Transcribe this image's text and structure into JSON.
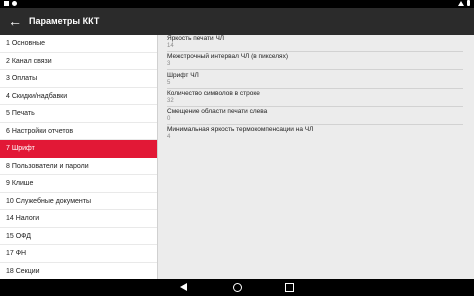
{
  "app_bar": {
    "title": "Параметры ККТ"
  },
  "sidebar": {
    "items": [
      {
        "label": "1 Основные"
      },
      {
        "label": "2 Канал связи"
      },
      {
        "label": "3 Оплаты"
      },
      {
        "label": "4 Скидки/надбавки"
      },
      {
        "label": "5 Печать"
      },
      {
        "label": "6 Настройки отчетов"
      },
      {
        "label": "7 Шрифт"
      },
      {
        "label": "8 Пользователи и пароли"
      },
      {
        "label": "9 Клише"
      },
      {
        "label": "10 Служебные документы"
      },
      {
        "label": "14 Налоги"
      },
      {
        "label": "15 ОФД"
      },
      {
        "label": "17 ФН"
      },
      {
        "label": "18 Секции"
      }
    ],
    "active_index": 6
  },
  "settings": [
    {
      "label": "Яркость печати ЧЛ",
      "value": "14"
    },
    {
      "label": "Межстрочный интервал ЧЛ (в пикселях)",
      "value": "3"
    },
    {
      "label": "Шрифт ЧЛ",
      "value": "5"
    },
    {
      "label": "Количество символов в строке",
      "value": "32"
    },
    {
      "label": "Смещение области печати слева",
      "value": "0"
    },
    {
      "label": "Минимальная яркость термокомпенсации на ЧЛ",
      "value": "4"
    }
  ],
  "colors": {
    "accent": "#e21836",
    "app_bar": "#2b2b2b"
  },
  "icons": {
    "status_left": [
      "notification-icon",
      "screenshot-icon"
    ],
    "status_right": [
      "wifi-icon",
      "battery-icon"
    ],
    "back": "arrow-left-icon",
    "nav": [
      "nav-back-icon",
      "nav-home-icon",
      "nav-recents-icon"
    ]
  }
}
